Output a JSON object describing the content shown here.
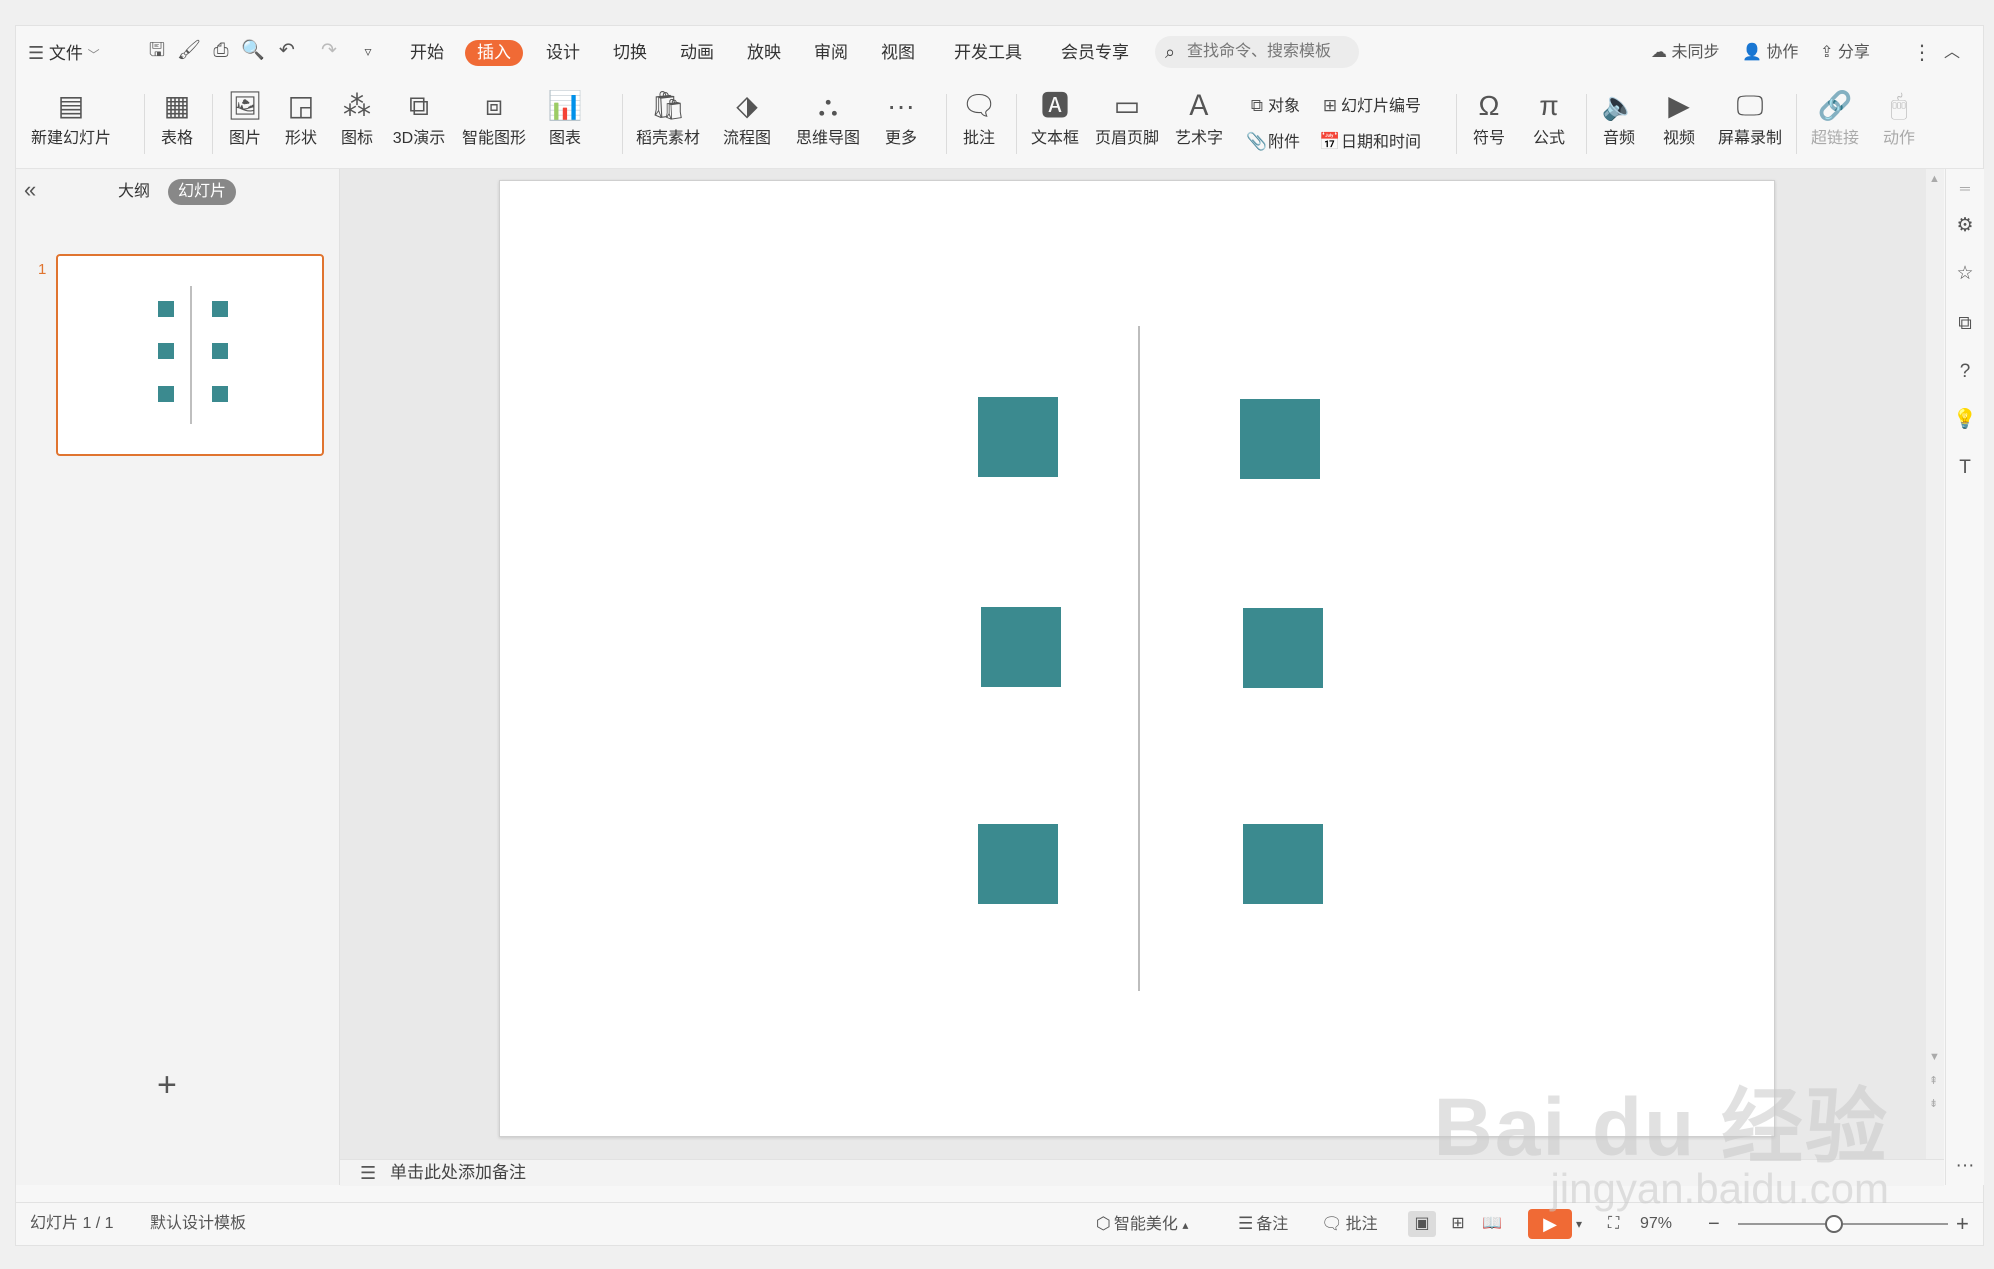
{
  "menubar": {
    "file_label": "文件",
    "tabs": [
      "开始",
      "插入",
      "设计",
      "切换",
      "动画",
      "放映",
      "审阅",
      "视图",
      "开发工具",
      "会员专享"
    ],
    "active_tab": "插入",
    "search_placeholder": "查找命令、搜索模板",
    "sync": "未同步",
    "collab": "协作",
    "share": "分享"
  },
  "ribbon": {
    "new_slide": "新建幻灯片",
    "table": "表格",
    "picture": "图片",
    "shape": "形状",
    "icon": "图标",
    "demo3d": "3D演示",
    "smart_graphic": "智能图形",
    "chart": "图表",
    "material": "稻壳素材",
    "flowchart": "流程图",
    "mindmap": "思维导图",
    "more": "更多",
    "comment": "批注",
    "textbox": "文本框",
    "header_footer": "页眉页脚",
    "wordart": "艺术字",
    "object": "对象",
    "slide_number": "幻灯片编号",
    "attachment": "附件",
    "datetime": "日期和时间",
    "symbol": "符号",
    "formula": "公式",
    "audio": "音频",
    "video": "视频",
    "screen_record": "屏幕录制",
    "hyperlink": "超链接",
    "action": "动作"
  },
  "panel": {
    "tab_outline": "大纲",
    "tab_slides": "幻灯片",
    "slide_number": "1"
  },
  "notes": {
    "placeholder": "单击此处添加备注"
  },
  "statusbar": {
    "slide_count": "幻灯片 1 / 1",
    "template": "默认设计模板",
    "beautify": "智能美化",
    "notes": "备注",
    "comments": "批注",
    "zoom": "97%"
  },
  "slide": {
    "shape_color": "#3b8a8f",
    "line_color": "#bdbdbd"
  },
  "colors": {
    "accent": "#f06a35",
    "selection": "#e0742f"
  },
  "watermark": {
    "line1": "Bai du 经验",
    "line2": "jingyan.baidu.com"
  }
}
